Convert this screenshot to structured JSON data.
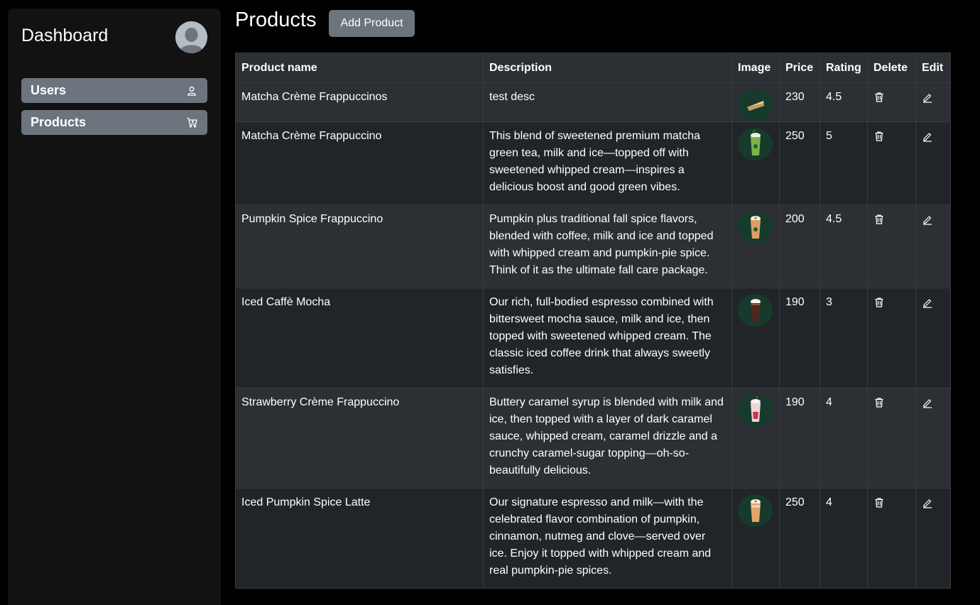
{
  "sidebar": {
    "title": "Dashboard",
    "avatar_icon": "user-avatar-icon",
    "items": [
      {
        "label": "Users",
        "icon": "person-icon"
      },
      {
        "label": "Products",
        "icon": "cart-icon"
      }
    ]
  },
  "main": {
    "title": "Products",
    "add_button_label": "Add Product",
    "table": {
      "headers": [
        "Product name",
        "Description",
        "Image",
        "Price",
        "Rating",
        "Delete",
        "Edit"
      ],
      "rows": [
        {
          "name": "Matcha Crème Frappuccinos",
          "description": "test desc",
          "image": "crepe",
          "price": "230",
          "rating": "4.5"
        },
        {
          "name": "Matcha Crème Frappuccino",
          "description": "This blend of sweetened premium matcha green tea, milk and ice—topped off with sweetened whipped cream—inspires a delicious boost and good green vibes.",
          "image": "matcha",
          "price": "250",
          "rating": "5"
        },
        {
          "name": "Pumpkin Spice Frappuccino",
          "description": "Pumpkin plus traditional fall spice flavors, blended with coffee, milk and ice and topped with whipped cream and pumpkin-pie spice. Think of it as the ultimate fall care package.",
          "image": "pumpkin",
          "price": "200",
          "rating": "4.5"
        },
        {
          "name": "Iced Caffè Mocha",
          "description": "Our rich, full-bodied espresso combined with bittersweet mocha sauce, milk and ice, then topped with sweetened whipped cream. The classic iced coffee drink that always sweetly satisfies.",
          "image": "mocha",
          "price": "190",
          "rating": "3"
        },
        {
          "name": "Strawberry Crème Frappuccino",
          "description": "Buttery caramel syrup is blended with milk and ice, then topped with a layer of dark caramel sauce, whipped cream, caramel drizzle and a crunchy caramel-sugar topping—oh-so-beautifully delicious.",
          "image": "strawberry",
          "price": "190",
          "rating": "4"
        },
        {
          "name": "Iced Pumpkin Spice Latte",
          "description": "Our signature espresso and milk—with the celebrated flavor combination of pumpkin, cinnamon, nutmeg and clove—served over ice. Enjoy it topped with whipped cream and real pumpkin-pie spices.",
          "image": "pumpkin-latte",
          "price": "250",
          "rating": "4"
        }
      ],
      "delete_icon": "trash-icon",
      "edit_icon": "pencil-icon"
    }
  },
  "colors": {
    "background": "#000000",
    "sidebar": "#121212",
    "button": "#6c757d",
    "table_dark": "#212529",
    "table_striped": "#2c3034",
    "thumb_bg": "#163a2c"
  }
}
